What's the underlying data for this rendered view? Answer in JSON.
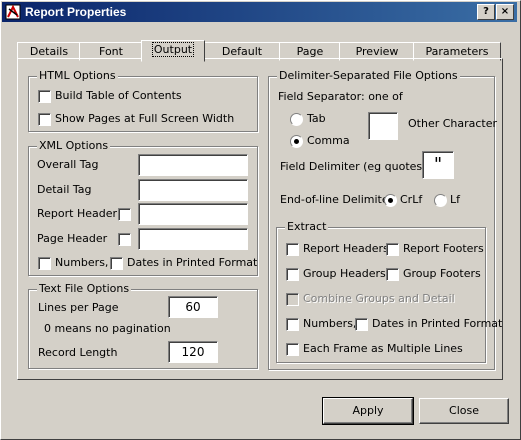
{
  "window": {
    "title": "Report Properties",
    "close_glyph": "?",
    "help_glyph": "×"
  },
  "tabs": [
    {
      "label": "Details"
    },
    {
      "label": "Font"
    },
    {
      "label": "Output",
      "active": true
    },
    {
      "label": "Default"
    },
    {
      "label": "Page"
    },
    {
      "label": "Preview"
    },
    {
      "label": "Parameters"
    }
  ],
  "html_options": {
    "title": "HTML Options",
    "build_toc": {
      "label": "Build Table of Contents",
      "checked": false
    },
    "full_screen": {
      "label": "Show Pages at Full Screen Width",
      "checked": false
    }
  },
  "xml_options": {
    "title": "XML Options",
    "overall_tag": {
      "label": "Overall Tag",
      "value": ""
    },
    "detail_tag": {
      "label": "Detail Tag",
      "value": ""
    },
    "report_header": {
      "label": "Report Header",
      "value": ""
    },
    "page_header": {
      "label": "Page Header",
      "value": ""
    },
    "numbers": {
      "label": "Numbers,",
      "checked": false
    },
    "dates": {
      "label": "Dates in Printed Format",
      "checked": false
    }
  },
  "text_file_options": {
    "title": "Text File Options",
    "lines_per_page": {
      "label": "Lines per Page",
      "value": "60"
    },
    "no_pagination_note": "0 means no pagination",
    "record_length": {
      "label": "Record Length",
      "value": "120"
    }
  },
  "delimiter_options": {
    "title": "Delimiter-Separated File Options",
    "field_separator_label": "Field Separator: one of",
    "tab": {
      "label": "Tab",
      "selected": false
    },
    "comma": {
      "label": "Comma",
      "selected": true
    },
    "other_character": {
      "label": "Other Character",
      "value": ""
    },
    "field_delimiter": {
      "label": "Field Delimiter (eg quotes)",
      "value": "\""
    },
    "eol_label": "End-of-line Delimiter:",
    "crlf": {
      "label": "CrLf",
      "selected": true
    },
    "lf": {
      "label": "Lf",
      "selected": false
    }
  },
  "extract": {
    "title": "Extract",
    "report_headers": {
      "label": "Report Headers",
      "checked": false
    },
    "report_footers": {
      "label": "Report Footers",
      "checked": false
    },
    "group_headers": {
      "label": "Group Headers",
      "checked": false
    },
    "group_footers": {
      "label": "Group Footers",
      "checked": false
    },
    "combine_groups": {
      "label": "Combine Groups and Detail",
      "checked": false,
      "disabled": true
    },
    "numbers": {
      "label": "Numbers,",
      "checked": false
    },
    "dates": {
      "label": "Dates in Printed Format",
      "checked": false
    },
    "each_frame": {
      "label": "Each Frame as Multiple Lines",
      "checked": false
    }
  },
  "buttons": {
    "apply": "Apply",
    "close": "Close"
  }
}
